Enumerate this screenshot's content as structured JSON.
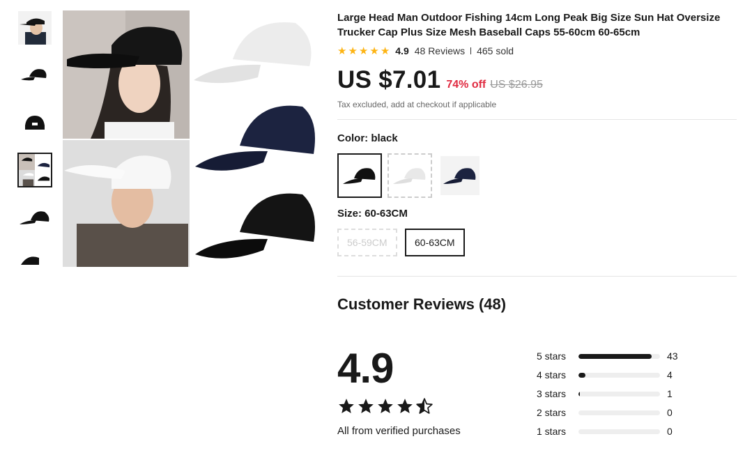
{
  "product": {
    "title": "Large Head Man Outdoor Fishing 14cm Long Peak Big Size Sun Hat Oversize Trucker Cap Plus Size Mesh Baseball Caps 55-60cm 60-65cm",
    "rating": "4.9",
    "reviews_link": "48 Reviews",
    "sold": "465 sold",
    "price": "US $7.01",
    "discount": "74% off",
    "original_price": "US $26.95",
    "tax_note": "Tax excluded, add at checkout if applicable"
  },
  "color": {
    "label": "Color: black",
    "options": [
      {
        "name": "black",
        "state": "selected"
      },
      {
        "name": "white",
        "state": "unavailable"
      },
      {
        "name": "navy",
        "state": "normal"
      }
    ]
  },
  "size": {
    "label": "Size: 60-63CM",
    "options": [
      {
        "name": "56-59CM",
        "state": "disabled"
      },
      {
        "name": "60-63CM",
        "state": "selected"
      }
    ]
  },
  "reviews": {
    "title": "Customer Reviews (48)",
    "score": "4.9",
    "stars": 4.9,
    "verified_note": "All from verified purchases",
    "distribution": [
      {
        "label": "5 stars",
        "count": "43",
        "fraction": 0.896
      },
      {
        "label": "4 stars",
        "count": "4",
        "fraction": 0.083
      },
      {
        "label": "3 stars",
        "count": "1",
        "fraction": 0.021
      },
      {
        "label": "2 stars",
        "count": "0",
        "fraction": 0
      },
      {
        "label": "1 stars",
        "count": "0",
        "fraction": 0
      }
    ]
  },
  "gallery": {
    "thumbnails": [
      "cap-on-person",
      "black-cap",
      "black-cap-back",
      "collage",
      "black-cap-side",
      "black-cap-partial"
    ],
    "active_thumbnail": 3
  },
  "colors": {
    "star": "#fdb414",
    "discount": "#e02b41",
    "text": "#191919"
  },
  "icons": {
    "rating_star": "star-icon"
  }
}
